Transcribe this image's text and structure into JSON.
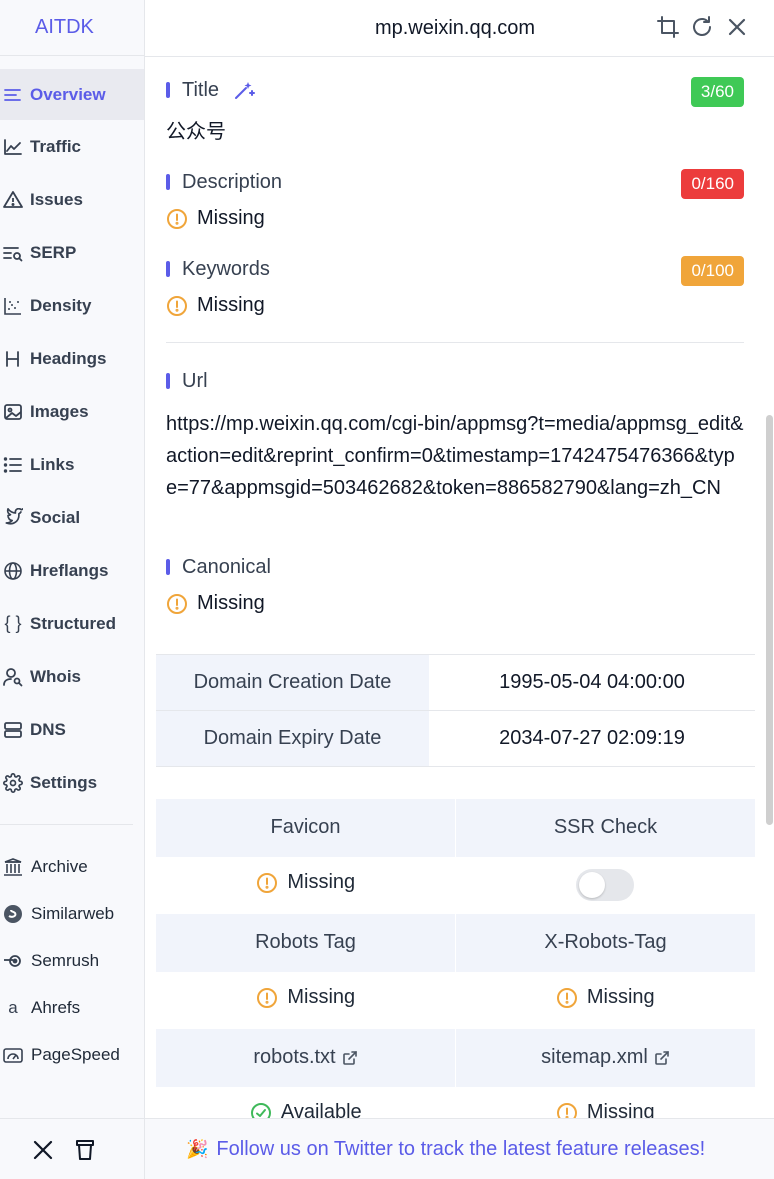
{
  "app": {
    "name": "AITDK"
  },
  "header": {
    "domain": "mp.weixin.qq.com"
  },
  "nav": [
    {
      "label": "Overview",
      "icon": "overview-icon"
    },
    {
      "label": "Traffic",
      "icon": "traffic-icon"
    },
    {
      "label": "Issues",
      "icon": "issues-icon"
    },
    {
      "label": "SERP",
      "icon": "serp-icon"
    },
    {
      "label": "Density",
      "icon": "density-icon"
    },
    {
      "label": "Headings",
      "icon": "headings-icon"
    },
    {
      "label": "Images",
      "icon": "images-icon"
    },
    {
      "label": "Links",
      "icon": "links-icon"
    },
    {
      "label": "Social",
      "icon": "social-icon"
    },
    {
      "label": "Hreflangs",
      "icon": "hreflangs-icon"
    },
    {
      "label": "Structured",
      "icon": "structured-icon"
    },
    {
      "label": "Whois",
      "icon": "whois-icon"
    },
    {
      "label": "DNS",
      "icon": "dns-icon"
    },
    {
      "label": "Settings",
      "icon": "settings-icon"
    }
  ],
  "external": [
    {
      "label": "Archive",
      "icon": "archive-icon"
    },
    {
      "label": "Similarweb",
      "icon": "similarweb-icon"
    },
    {
      "label": "Semrush",
      "icon": "semrush-icon"
    },
    {
      "label": "Ahrefs",
      "icon": "ahrefs-icon"
    },
    {
      "label": "PageSpeed",
      "icon": "pagespeed-icon"
    }
  ],
  "overview": {
    "title": {
      "label": "Title",
      "value": "公众号",
      "count": "3/60",
      "color": "#3fc956"
    },
    "description": {
      "label": "Description",
      "value": "Missing",
      "count": "0/160",
      "color": "#ec3c3c"
    },
    "keywords": {
      "label": "Keywords",
      "value": "Missing",
      "count": "0/100",
      "color": "#f0a53a"
    },
    "url": {
      "label": "Url",
      "value": "https://mp.weixin.qq.com/cgi-bin/appmsg?t=media/appmsg_edit&action=edit&reprint_confirm=0&timestamp=1742475476366&type=77&appmsgid=503462682&token=886582790&lang=zh_CN"
    },
    "canonical": {
      "label": "Canonical",
      "value": "Missing"
    }
  },
  "domain": {
    "creation_label": "Domain Creation Date",
    "creation_value": "1995-05-04 04:00:00",
    "expiry_label": "Domain Expiry Date",
    "expiry_value": "2034-07-27 02:09:19"
  },
  "checks": {
    "favicon_label": "Favicon",
    "favicon_value": "Missing",
    "ssr_label": "SSR Check",
    "robots_tag_label": "Robots Tag",
    "robots_tag_value": "Missing",
    "x_robots_label": "X-Robots-Tag",
    "x_robots_value": "Missing",
    "robots_txt_label": "robots.txt",
    "robots_txt_value": "Available",
    "sitemap_label": "sitemap.xml",
    "sitemap_value": "Missing"
  },
  "footer": {
    "message": "Follow us on Twitter to track the latest feature releases!",
    "emoji": "🎉"
  },
  "colors": {
    "accent": "#5b5ce8",
    "warning": "#f0a53a",
    "success": "#3fb95a"
  }
}
